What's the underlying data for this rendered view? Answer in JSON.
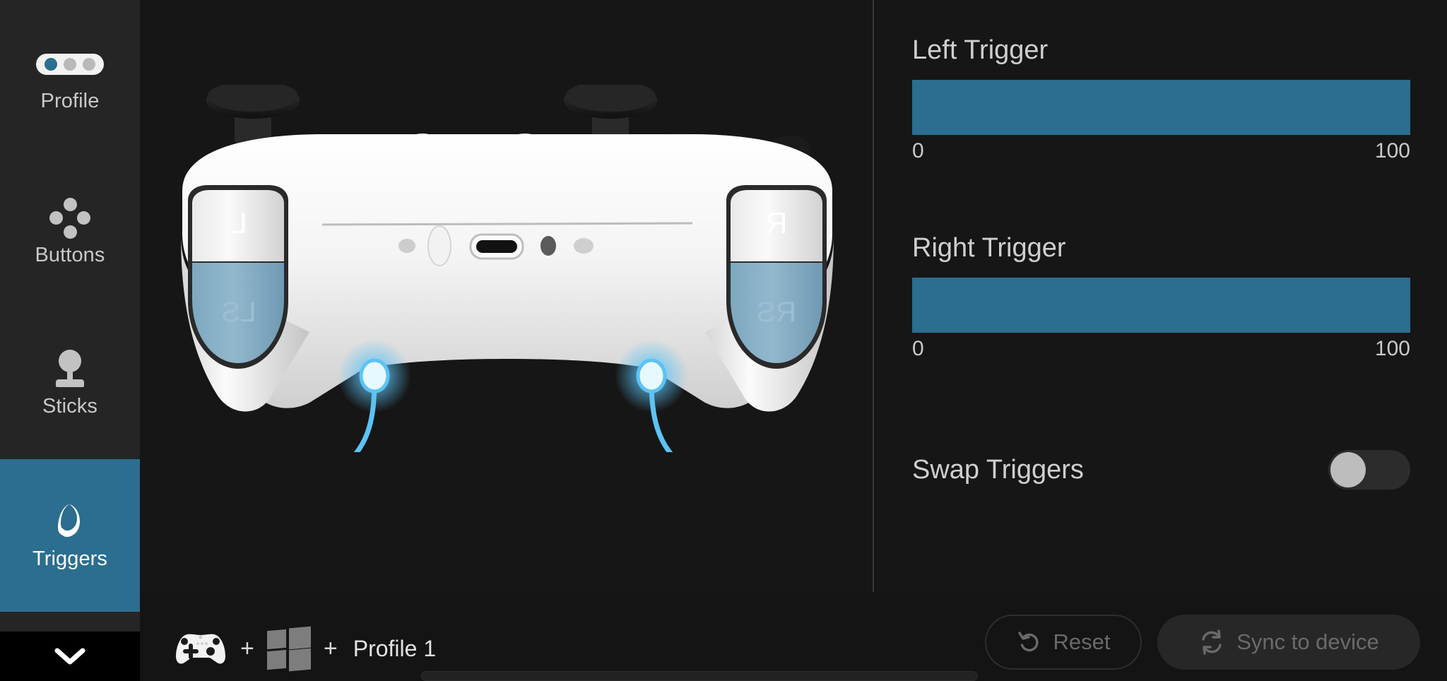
{
  "sidebar": {
    "items": [
      {
        "id": "profile",
        "label": "Profile",
        "icon": "profile-dots-icon",
        "selected": false
      },
      {
        "id": "buttons",
        "label": "Buttons",
        "icon": "dpad-dots-icon",
        "selected": false
      },
      {
        "id": "sticks",
        "label": "Sticks",
        "icon": "joystick-icon",
        "selected": false
      },
      {
        "id": "triggers",
        "label": "Triggers",
        "icon": "trigger-icon",
        "selected": true
      }
    ],
    "collapse_icon": "chevron-down-icon",
    "selected_color": "#2b6e8f"
  },
  "stage": {
    "device_image": "controller-back-view",
    "trigger_labels": {
      "left": "L",
      "right": "R"
    },
    "stick_labels": {
      "left": "LS",
      "right": "RS"
    },
    "callout_color": "#5cc3f5",
    "trigger_fill_color": "#85aec6"
  },
  "panel": {
    "left_trigger": {
      "label": "Left Trigger",
      "min_label": "0",
      "max_label": "100",
      "min": 0,
      "max": 100,
      "range_start": 0,
      "range_end": 100,
      "fill_color": "#2b6e8f"
    },
    "right_trigger": {
      "label": "Right Trigger",
      "min_label": "0",
      "max_label": "100",
      "min": 0,
      "max": 100,
      "range_start": 0,
      "range_end": 100,
      "fill_color": "#2b6e8f"
    },
    "swap_triggers": {
      "label": "Swap Triggers",
      "state": "off"
    }
  },
  "bottom_bar": {
    "device_icon": "gamepad-icon",
    "separator_1": "+",
    "platform_icon": "windows-icon",
    "separator_2": "+",
    "profile_name": "Profile 1",
    "reset_button": {
      "label": "Reset",
      "icon": "undo-icon",
      "disabled": true
    },
    "sync_button": {
      "label": "Sync to device",
      "icon": "refresh-icon",
      "disabled": true
    }
  }
}
